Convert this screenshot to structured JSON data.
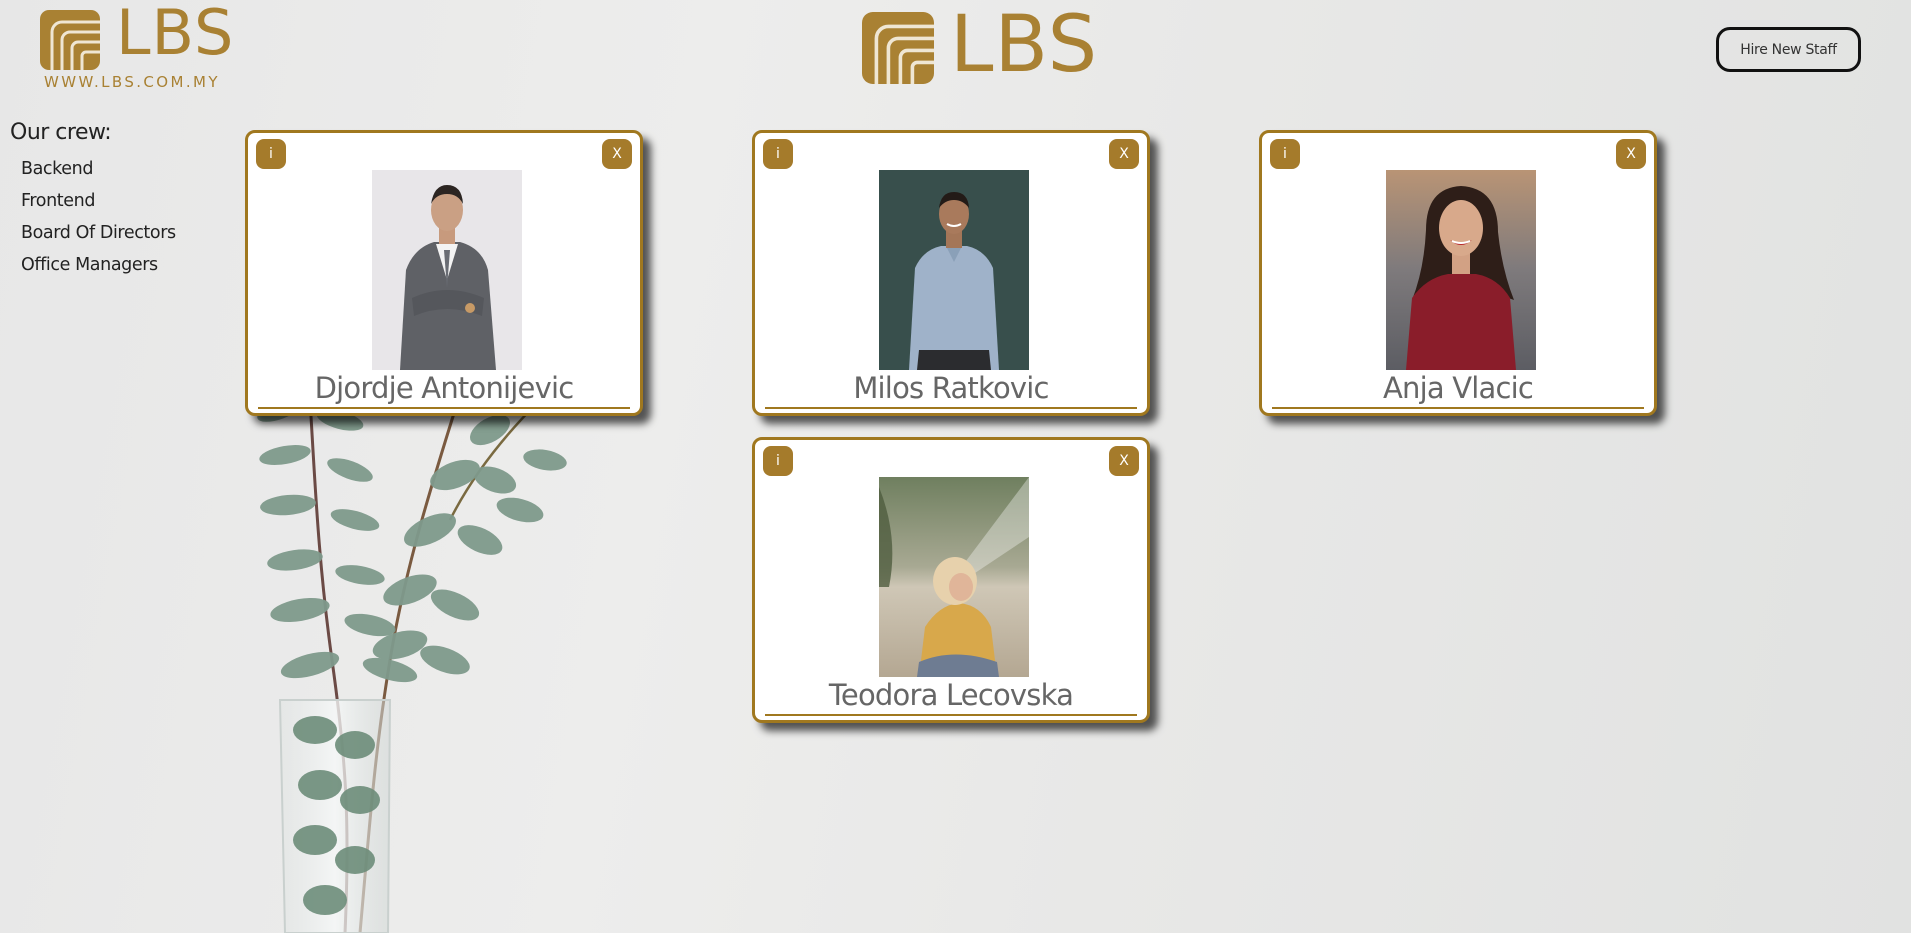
{
  "logo_top_left": {
    "brand": "LBS",
    "url": "WWW.LBS.COM.MY"
  },
  "logo_center": {
    "brand": "LBS"
  },
  "header": {
    "hire_button_label": "Hire New Staff"
  },
  "sidebar": {
    "title": "Our crew:",
    "items": [
      {
        "label": "Backend"
      },
      {
        "label": "Frontend"
      },
      {
        "label": "Board Of Directors"
      },
      {
        "label": "Office Managers"
      }
    ]
  },
  "cards": [
    {
      "name": "Djordje Antonijevic",
      "info_label": "i",
      "close_label": "X"
    },
    {
      "name": "Milos Ratkovic",
      "info_label": "i",
      "close_label": "X"
    },
    {
      "name": "Anja Vlacic",
      "info_label": "i",
      "close_label": "X"
    },
    {
      "name": "Teodora Lecovska",
      "info_label": "i",
      "close_label": "X"
    }
  ],
  "colors": {
    "brand_gold": "#a98133",
    "card_border": "#a0781f",
    "button_gold": "#a57b2b"
  }
}
